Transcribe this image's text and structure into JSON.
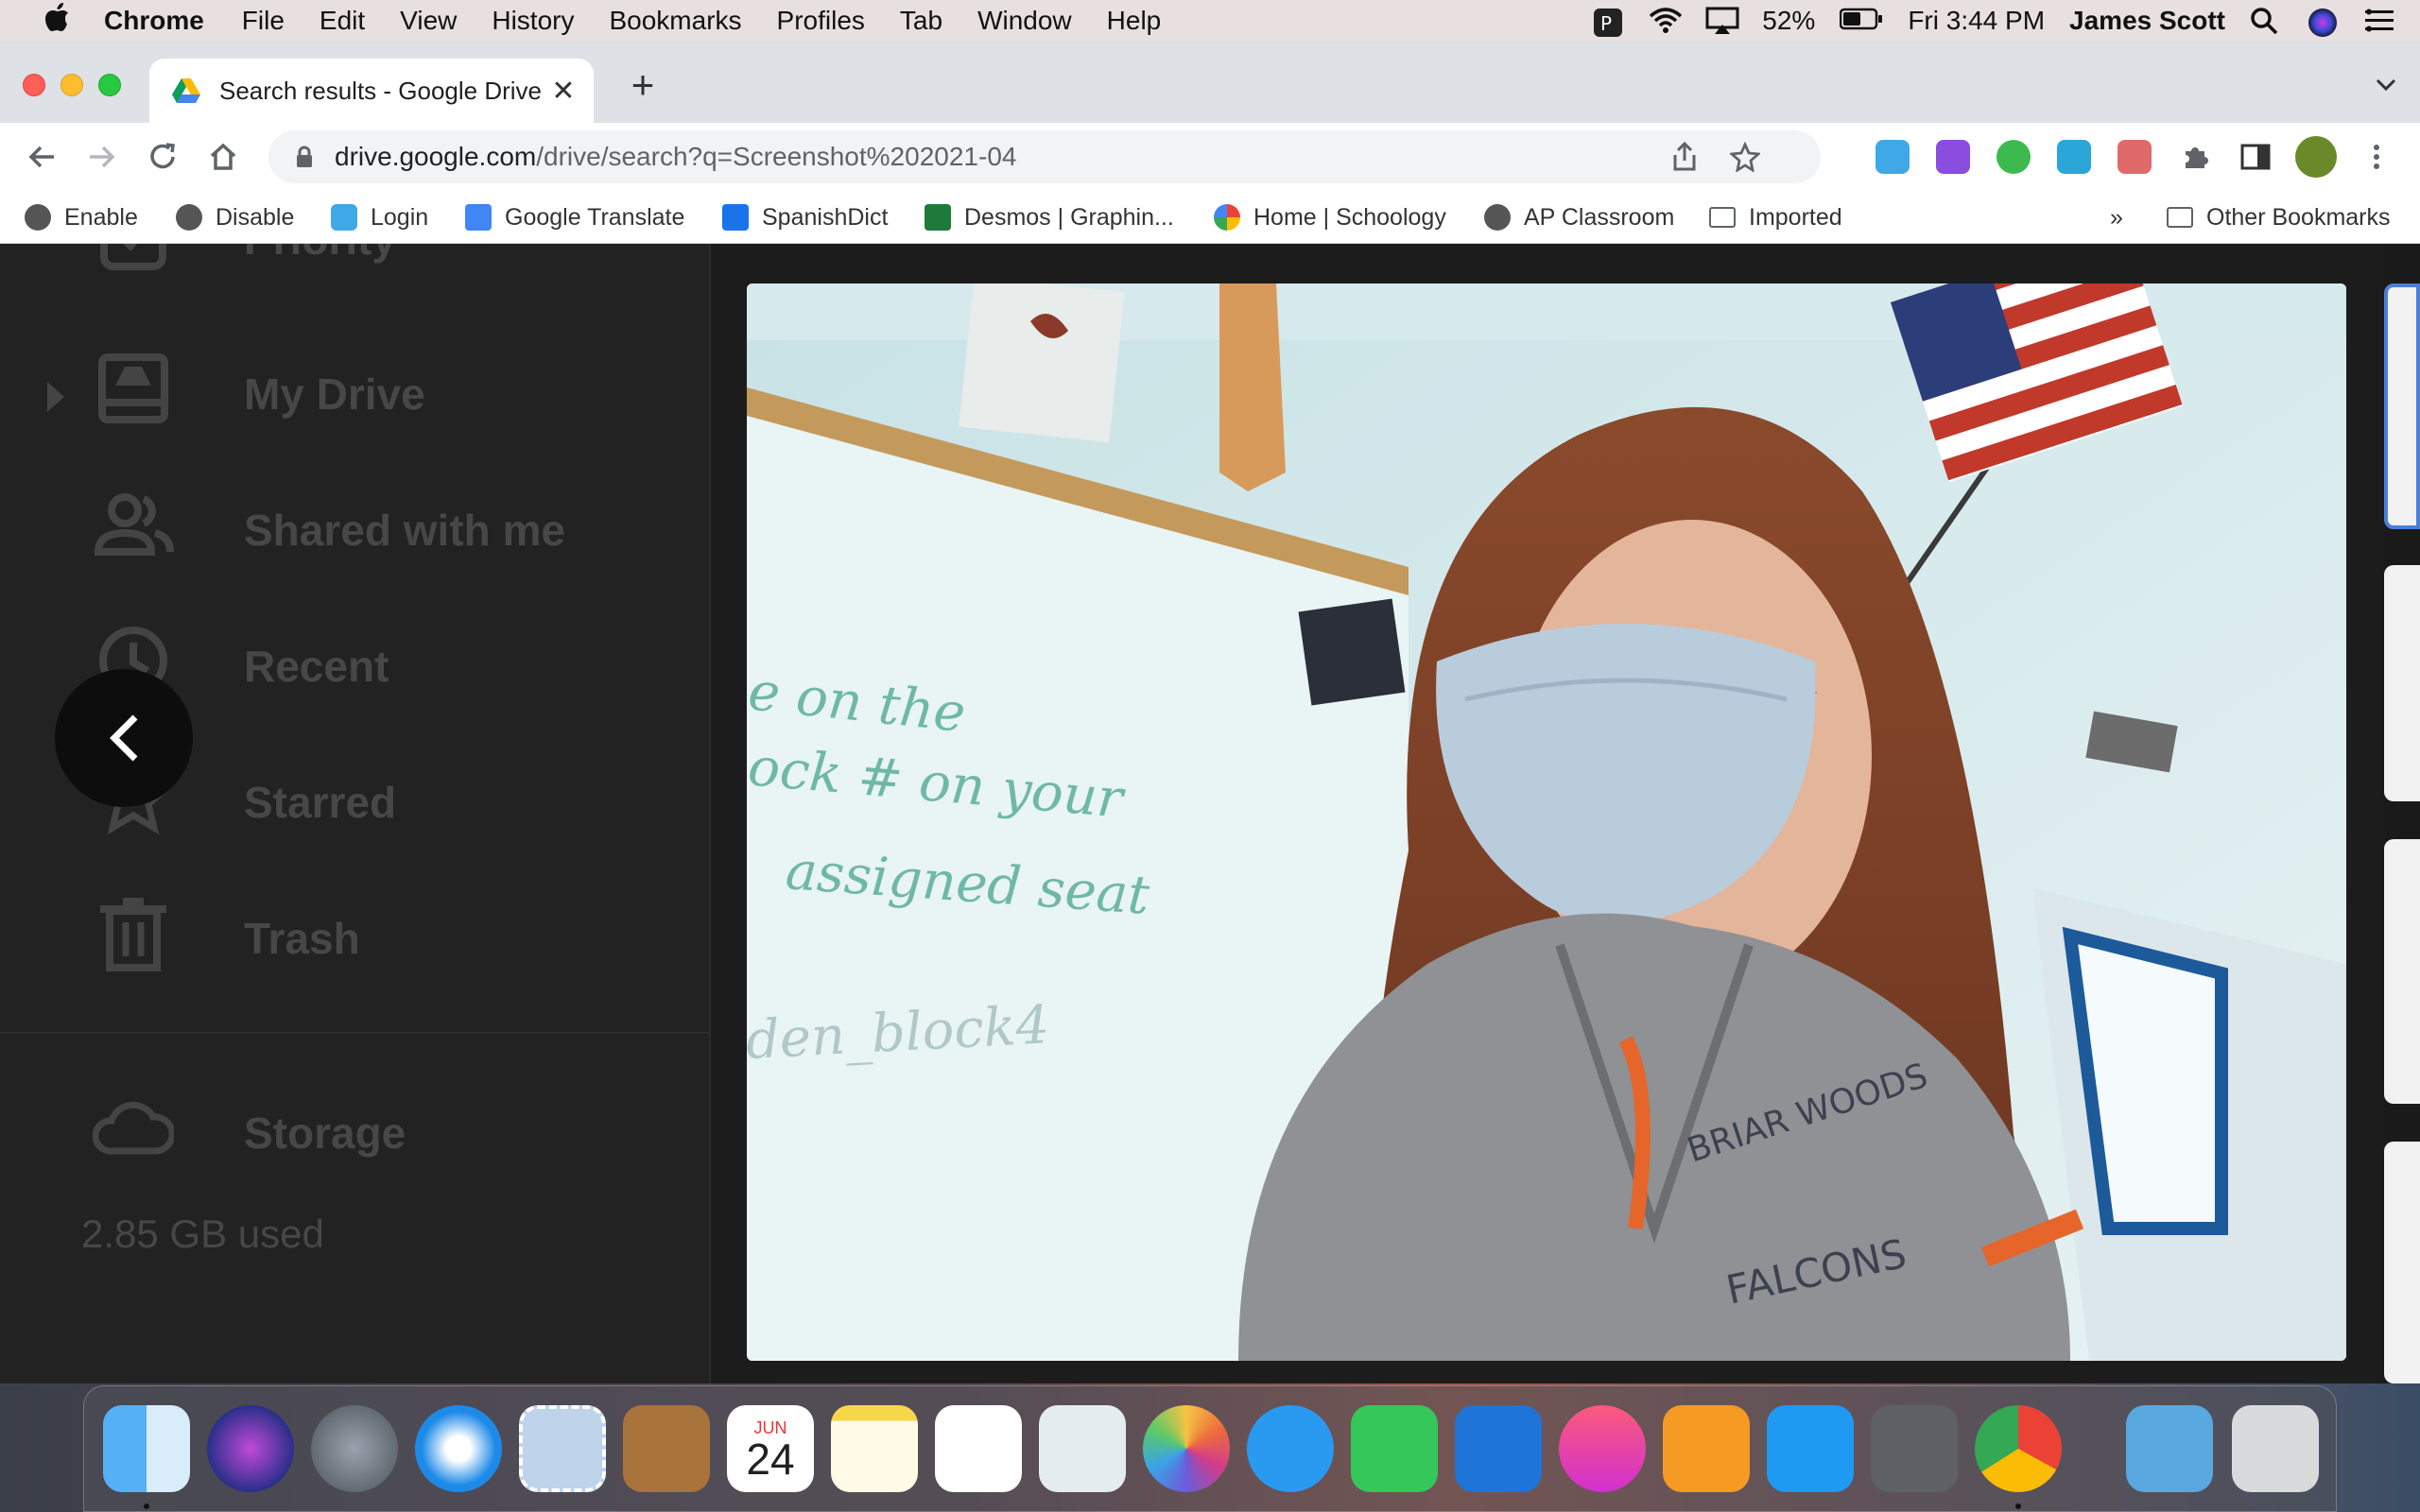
{
  "menubar": {
    "app_name": "Chrome",
    "menus": [
      "File",
      "Edit",
      "View",
      "History",
      "Bookmarks",
      "Profiles",
      "Tab",
      "Window",
      "Help"
    ],
    "battery": "52%",
    "clock": "Fri 3:44 PM",
    "user": "James Scott"
  },
  "tab": {
    "title": "Search results - Google Drive",
    "close": "✕",
    "new_tab": "+"
  },
  "toolbar": {
    "url_host": "drive.google.com",
    "url_path": "/drive/search?q=Screenshot%202021-04"
  },
  "bookmarks": {
    "items": [
      "Enable",
      "Disable",
      "Login",
      "Google Translate",
      "SpanishDict",
      "Desmos | Graphin...",
      "Home | Schoology",
      "AP Classroom",
      "Imported"
    ],
    "overflow": "»",
    "other": "Other Bookmarks"
  },
  "sidebar": {
    "items": [
      {
        "label": "Priority"
      },
      {
        "label": "My Drive"
      },
      {
        "label": "Shared with me"
      },
      {
        "label": "Recent"
      },
      {
        "label": "Starred"
      },
      {
        "label": "Trash"
      },
      {
        "label": "Storage"
      }
    ],
    "storage_used": "2.85 GB used"
  },
  "video": {
    "whiteboard_lines": [
      "e on the",
      "ock # on your",
      "assigned seat",
      "den_block4"
    ],
    "shirt_text_top": "BRIAR WOODS",
    "shirt_text_bottom": "FALCONS"
  },
  "dock": {
    "calendar_month": "JUN",
    "calendar_day": "24"
  },
  "colors": {
    "sidebar_bg": "#222222",
    "sidebar_text": "#474747",
    "chrome_tabstrip": "#dee1e6",
    "menubar_bg": "#e7dfe0"
  }
}
